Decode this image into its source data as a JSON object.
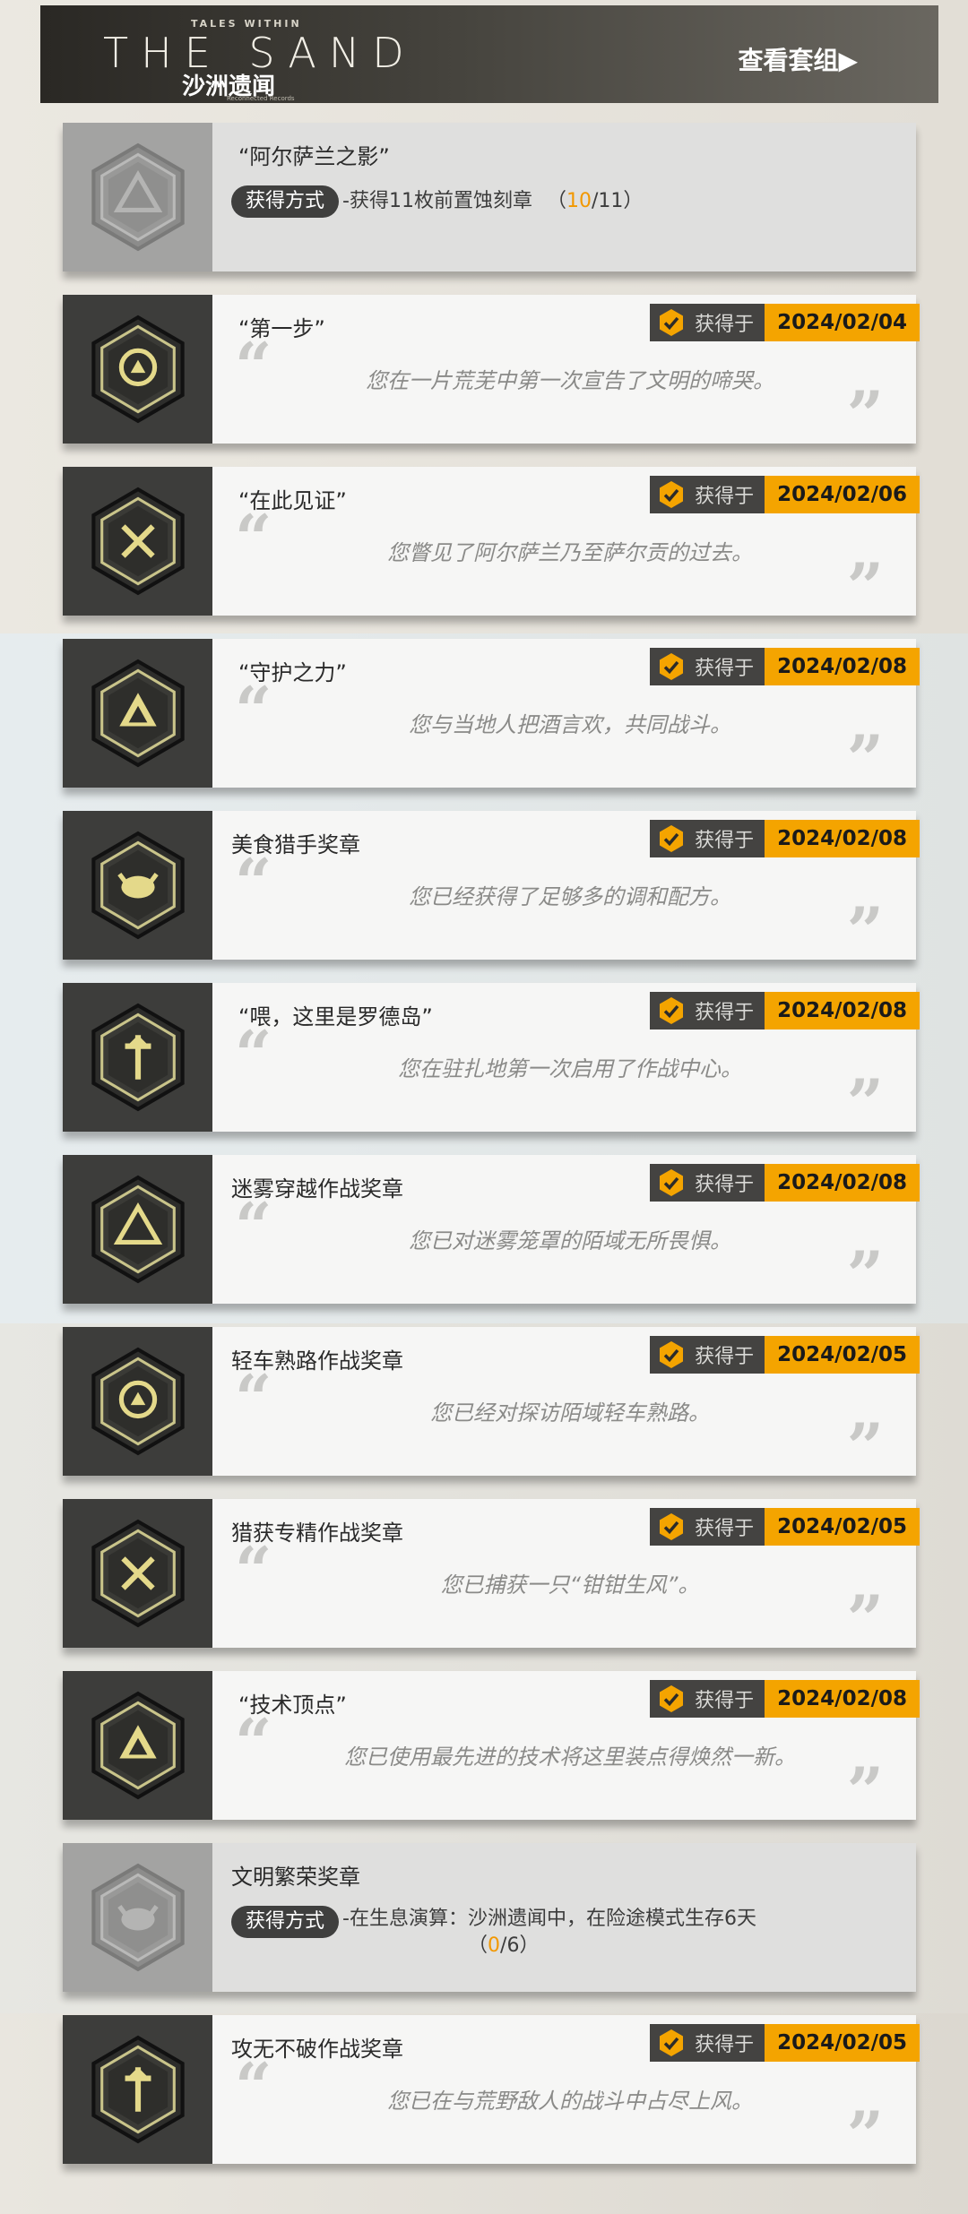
{
  "banner": {
    "small_text": "TALES WITHIN",
    "logo_text": "THE SAND",
    "logo_cn": "沙洲遗闻",
    "logo_sub": "Reconnected Records",
    "view_set_label": "查看套组▶"
  },
  "colors": {
    "accent": "#f4a400",
    "progress_highlight": "#f29800",
    "badge_dark": "#444341"
  },
  "obtained_label": "获得于",
  "method_label": "获得方式",
  "medals": [
    {
      "title": "“阿尔萨兰之影”",
      "locked": true,
      "method": "-获得11枚前置蚀刻章",
      "progress_open": "（",
      "progress_current": "10",
      "progress_total": "/11）",
      "icon": "triangle-mountain-medal-icon"
    },
    {
      "title": "“第一步”",
      "locked": false,
      "date": "2024/02/04",
      "desc": "您在一片荒芜中第一次宣告了文明的啼哭。",
      "icon": "first-step-medal-icon"
    },
    {
      "title": "“在此见证”",
      "locked": false,
      "date": "2024/02/06",
      "desc": "您瞥见了阿尔萨兰乃至萨尔贡的过去。",
      "icon": "witness-bearer-medal-icon"
    },
    {
      "title": "“守护之力”",
      "locked": false,
      "date": "2024/02/08",
      "desc": "您与当地人把酒言欢，共同战斗。",
      "icon": "guardian-power-medal-icon"
    },
    {
      "title": "美食猎手奖章",
      "locked": false,
      "date": "2024/02/08",
      "desc": "您已经获得了足够多的调和配方。",
      "icon": "food-hunter-medal-icon"
    },
    {
      "title": "“喂，这里是罗德岛”",
      "locked": false,
      "date": "2024/02/08",
      "desc": "您在驻扎地第一次启用了作战中心。",
      "icon": "rhodes-island-medal-icon"
    },
    {
      "title": "迷雾穿越作战奖章",
      "locked": false,
      "date": "2024/02/08",
      "desc": "您已对迷雾笼罩的陌域无所畏惧。",
      "icon": "mist-traverser-medal-icon"
    },
    {
      "title": "轻车熟路作战奖章",
      "locked": false,
      "date": "2024/02/05",
      "desc": "您已经对探访陌域轻车熟路。",
      "icon": "master-adventurer-medal-icon"
    },
    {
      "title": "猎获专精作战奖章",
      "locked": false,
      "date": "2024/02/05",
      "desc": "您已捕获一只“钳钳生风”。",
      "icon": "crab-hunt-medal-icon"
    },
    {
      "title": "“技术顶点”",
      "locked": false,
      "date": "2024/02/08",
      "desc": "您已使用最先进的技术将这里装点得焕然一新。",
      "icon": "tech-peak-medal-icon"
    },
    {
      "title": "文明繁荣奖章",
      "locked": true,
      "method": "-在生息演算：沙洲遗闻中，在险途模式生存6天",
      "progress_open": "（",
      "progress_current": "0",
      "progress_total": "/6）",
      "icon": "civilization-prosperity-medal-icon"
    },
    {
      "title": "攻无不破作战奖章",
      "locked": false,
      "date": "2024/02/05",
      "desc": "您已在与荒野敌人的战斗中占尽上风。",
      "icon": "invincible-medal-icon"
    }
  ]
}
